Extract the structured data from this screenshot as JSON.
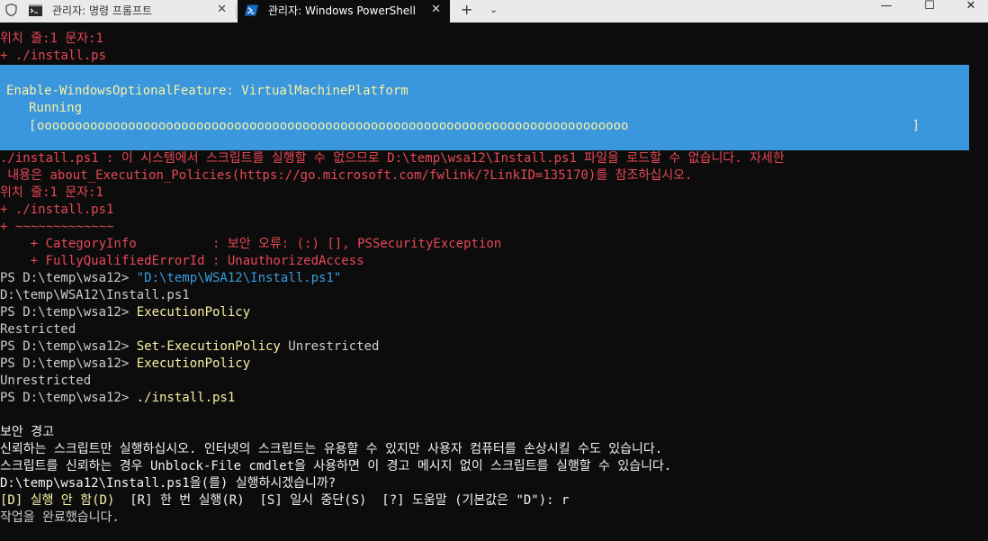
{
  "tabs": [
    {
      "title": "관리자: 명령 프롬프트",
      "icon": "cmd-icon",
      "close": "✕"
    },
    {
      "title": "관리자: Windows PowerShell",
      "icon": "powershell-icon",
      "close": "✕"
    }
  ],
  "tabbar": {
    "new_tab": "+",
    "dropdown": "⌄"
  },
  "window": {
    "minimize": "—",
    "maximize": "☐",
    "close": "✕"
  },
  "progress": {
    "activity": "Enable-WindowsOptionalFeature: VirtualMachinePlatform",
    "status": "Running",
    "open": "[",
    "fill": "oooooooooooooooooooooooooooooooooooooooooooooooooooooooooooooooooooooooooooooo",
    "close": "]",
    "percent": 78
  },
  "terminal": {
    "top_error": {
      "line1": "위치 줄:1 문자:1",
      "line2": "+ ./install.ps"
    },
    "error": {
      "line1": "./install.ps1 : 이 시스템에서 스크립트를 실행할 수 없으므로 D:\\temp\\wsa12\\Install.ps1 파일을 로드할 수 없습니다. 자세한",
      "line2": " 내용은 about_Execution_Policies(https://go.microsoft.com/fwlink/?LinkID=135170)를 참조하십시오.",
      "line3": "위치 줄:1 문자:1",
      "line4": "+ ./install.ps1",
      "line5": "+ ~~~~~~~~~~~~~",
      "cat_label": "    + CategoryInfo          : 보안 오류: (:) [], PSSecurityException",
      "fq_label": "    + FullyQualifiedErrorId : UnauthorizedAccess"
    },
    "prompt": "PS D:\\temp\\wsa12> ",
    "cmd1": "\"D:\\temp\\WSA12\\Install.ps1\"",
    "out1": "D:\\temp\\WSA12\\Install.ps1",
    "cmd2": "ExecutionPolicy",
    "out2": "Restricted",
    "cmd3_name": "Set-ExecutionPolicy",
    "cmd3_arg": " Unrestricted",
    "cmd4": "ExecutionPolicy",
    "out4": "Unrestricted",
    "cmd5": "./install.ps1",
    "warn_title": "보안 경고",
    "warn1": "신뢰하는 스크립트만 실행하십시오. 인터넷의 스크립트는 유용할 수 있지만 사용자 컴퓨터를 손상시킬 수도 있습니다.",
    "warn2": "스크립트를 신뢰하는 경우 Unblock-File cmdlet을 사용하면 이 경고 메시지 없이 스크립트를 실행할 수 있습니다.",
    "warn3": "D:\\temp\\wsa12\\Install.ps1을(를) 실행하시겠습니까?",
    "choice_default": "[D] 실행 안 함(D)",
    "choice_rest": "  [R] 한 번 실행(R)  [S] 일시 중단(S)  [?] 도움말 (기본값은 \"D\"): ",
    "answer": "r",
    "done": "작업을 완료했습니다."
  },
  "colors": {
    "background": "#0c0c0c",
    "error": "#e74856",
    "foreground": "#cccccc",
    "command": "#f9f1a5",
    "string": "#3b9cdf",
    "progress_bg": "#3a96dd"
  }
}
